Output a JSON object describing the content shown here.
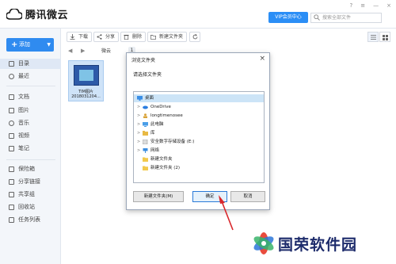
{
  "app": {
    "title": "腾讯微云"
  },
  "header": {
    "vip_label": "VIP会员中心",
    "search_placeholder": "搜索全部文件",
    "window_controls": [
      "?",
      "≡",
      "—",
      "×"
    ]
  },
  "sidebar": {
    "add_label": "添加",
    "items": [
      {
        "label": "目录",
        "icon": "directory-icon",
        "active": true
      },
      {
        "label": "最近",
        "icon": "clock-icon"
      },
      {
        "label": "文档",
        "icon": "document-icon"
      },
      {
        "label": "图片",
        "icon": "image-icon"
      },
      {
        "label": "音乐",
        "icon": "music-icon"
      },
      {
        "label": "视频",
        "icon": "video-icon"
      },
      {
        "label": "笔记",
        "icon": "note-icon"
      },
      {
        "label": "保险箱",
        "icon": "safe-icon"
      },
      {
        "label": "分享链接",
        "icon": "share-link-icon"
      },
      {
        "label": "共享组",
        "icon": "share-group-icon"
      },
      {
        "label": "回收站",
        "icon": "recycle-bin-icon"
      },
      {
        "label": "任务列表",
        "icon": "task-list-icon"
      }
    ]
  },
  "toolbar": {
    "download": "下载",
    "share": "分享",
    "delete": "删除",
    "new_folder": "新建文件夹"
  },
  "breadcrumb": {
    "root": "微云",
    "count": "1"
  },
  "file": {
    "name_line1": "TIM图片",
    "name_line2": "2018031204..."
  },
  "dialog": {
    "title": "浏览文件夹",
    "prompt": "请选择文件夹",
    "tree": [
      {
        "label": "桌面",
        "level": 0,
        "icon": "desktop-icon",
        "selected": true,
        "arrow": ""
      },
      {
        "label": "OneDrive",
        "level": 1,
        "icon": "cloud-icon",
        "arrow": ">"
      },
      {
        "label": "longtimenosee",
        "level": 1,
        "icon": "user-icon",
        "arrow": ">"
      },
      {
        "label": "此电脑",
        "level": 1,
        "icon": "computer-icon",
        "arrow": ">"
      },
      {
        "label": "库",
        "level": 1,
        "icon": "library-icon",
        "arrow": ">"
      },
      {
        "label": "安全数字存储设备 (E:)",
        "level": 1,
        "icon": "sd-card-icon",
        "arrow": ">"
      },
      {
        "label": "网络",
        "level": 1,
        "icon": "network-icon",
        "arrow": ">"
      },
      {
        "label": "新建文件夹",
        "level": 1,
        "icon": "folder-icon",
        "arrow": ""
      },
      {
        "label": "新建文件夹 (2)",
        "level": 1,
        "icon": "folder-icon",
        "arrow": ""
      }
    ],
    "new_folder_btn": "新建文件夹(M)",
    "ok_btn": "确定",
    "cancel_btn": "取消"
  },
  "watermark": {
    "text": "国荣软件园"
  },
  "colors": {
    "accent": "#2f8bf0",
    "sidebar_bg": "#f3f6fa",
    "dialog_border": "#9aa6b8"
  }
}
